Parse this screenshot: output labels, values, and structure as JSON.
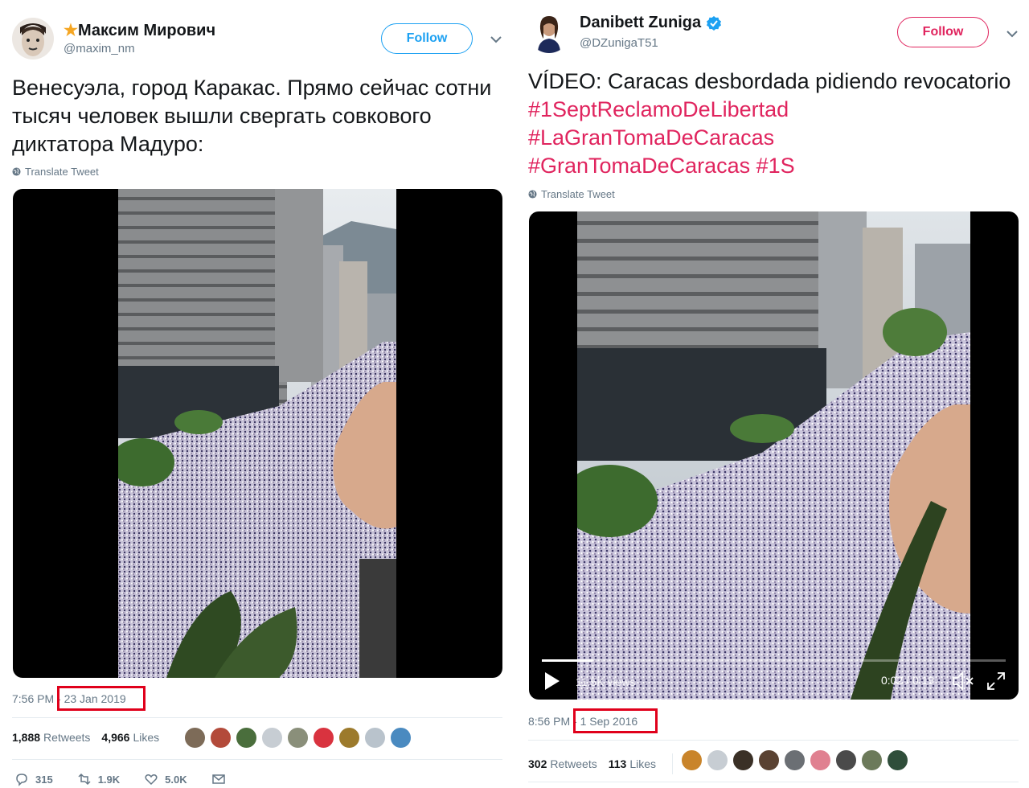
{
  "left_tweet": {
    "display_name": "Максим Мирович",
    "star_glyph": "★",
    "handle": "@maxim_nm",
    "follow_label": "Follow",
    "text": "Венесуэла, город Каракас. Прямо сейчас сотни тысяч человек вышли свергать совкового диктатора Мадуро:",
    "translate_label": "Translate Tweet",
    "time": "7:56 PM",
    "date": "- 23 Jan 2019",
    "retweets_count": "1,888",
    "retweets_label": "Retweets",
    "likes_count": "4,966",
    "likes_label": "Likes",
    "replies": "315",
    "retweets_short": "1.9K",
    "likes_short": "5.0K"
  },
  "right_tweet": {
    "display_name": "Danibett Zuniga",
    "handle": "@DZunigaT51",
    "follow_label": "Follow",
    "text_plain": "VÍDEO: Caracas desbordada pidiendo revocatorio",
    "hashtags": [
      "#1SeptReclamoDeLibertad",
      "#LaGranTomaDeCaracas",
      "#GranTomaDeCaracas",
      "#1S"
    ],
    "translate_label": "Translate Tweet",
    "video_views": "11.5K views",
    "video_time": "0:02 / 0:19",
    "video_progress": 0.11,
    "time": "8:56 PM",
    "date": "- 1 Sep 2016",
    "retweets_count": "302",
    "retweets_label": "Retweets",
    "likes_count": "113",
    "likes_label": "Likes"
  },
  "colors": {
    "follow_left": "#1da1f2",
    "follow_right": "#e0245e",
    "hashtag": "#e0245e",
    "highlight": "#e0001b",
    "verified": "#1da1f2",
    "star": "#f5a623"
  }
}
